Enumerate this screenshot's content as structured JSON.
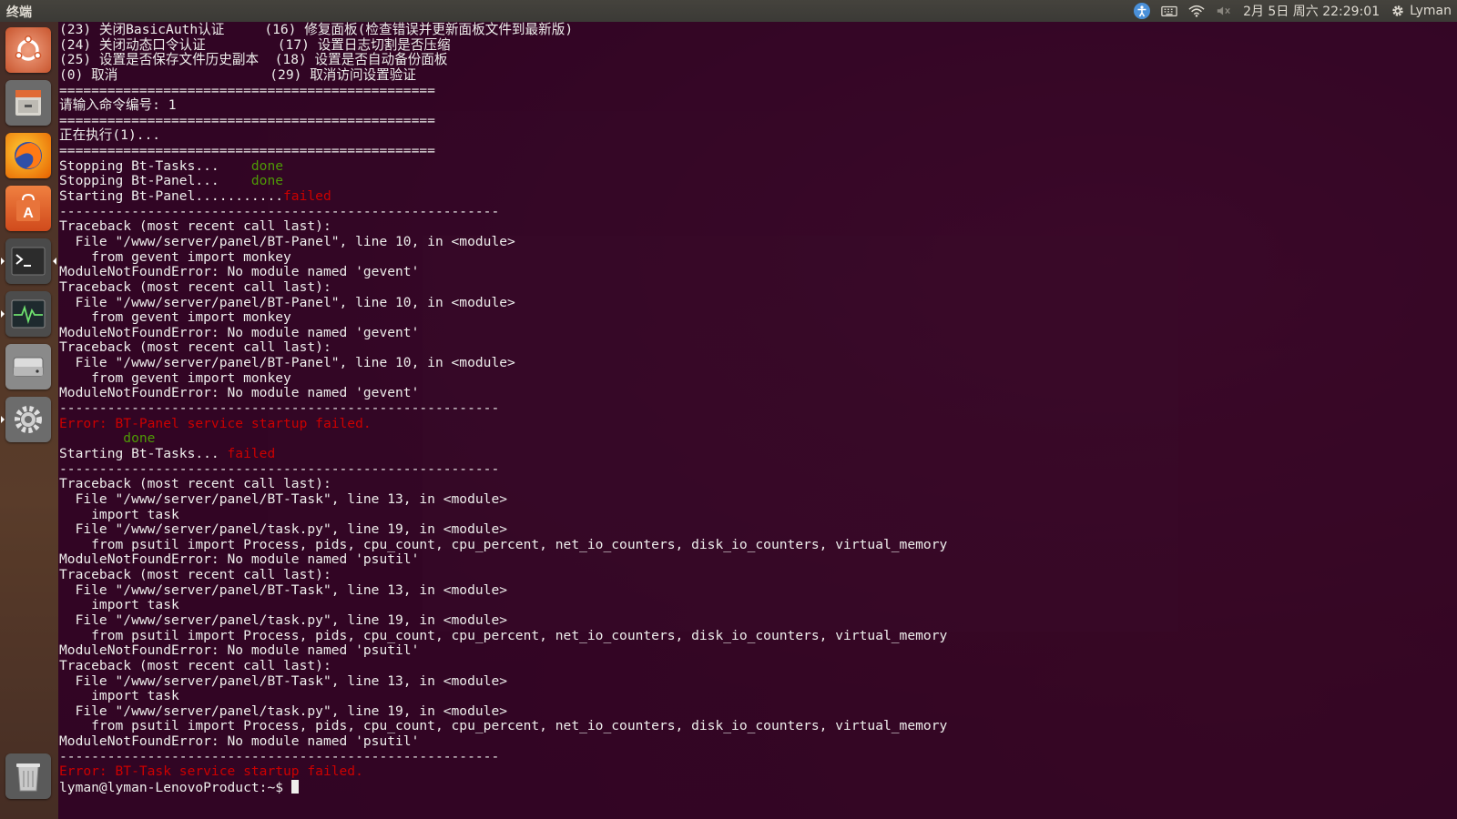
{
  "topbar": {
    "title": "终端",
    "clock": "2月 5日 周六 22:29:01",
    "user": "Lyman",
    "icons": [
      "accessibility-icon",
      "keyboard-icon",
      "wifi-icon",
      "volume-muted-icon",
      "gear-icon"
    ]
  },
  "launcher": {
    "items": [
      {
        "name": "ubuntu-dash",
        "icon": "ubuntu-logo-icon"
      },
      {
        "name": "files",
        "icon": "file-cabinet-icon"
      },
      {
        "name": "firefox",
        "icon": "firefox-icon"
      },
      {
        "name": "software-center",
        "icon": "software-bag-icon"
      },
      {
        "name": "terminal",
        "icon": "terminal-icon"
      },
      {
        "name": "system-monitor",
        "icon": "system-monitor-icon"
      },
      {
        "name": "drive",
        "icon": "drive-icon"
      },
      {
        "name": "system-settings",
        "icon": "settings-gear-icon"
      },
      {
        "name": "trash",
        "icon": "trash-icon"
      }
    ]
  },
  "terminal": {
    "menu": [
      "(23) 关闭BasicAuth认证     (16) 修复面板(检查错误并更新面板文件到最新版)",
      "(24) 关闭动态口令认证         (17) 设置日志切割是否压缩",
      "(25) 设置是否保存文件历史副本  (18) 设置是否自动备份面板",
      "(0) 取消                   (29) 取消访问设置验证"
    ],
    "sep_eq": "===============================================",
    "prompt_cmd": "请输入命令编号: 1",
    "executing": "正在执行(1)...",
    "stop_tasks": "Stopping Bt-Tasks...    ",
    "stop_panel": "Stopping Bt-Panel...    ",
    "start_panel": "Starting Bt-Panel...........",
    "done": "done",
    "failed": "failed",
    "sep_dash": "-------------------------------------------------------",
    "tb_head": "Traceback (most recent call last):",
    "panel_file": "  File \"/www/server/panel/BT-Panel\", line 10, in <module>",
    "panel_import": "    from gevent import monkey",
    "panel_err": "ModuleNotFoundError: No module named 'gevent'",
    "panel_fail": "Error: BT-Panel service startup failed.",
    "indent_done": "        done",
    "start_tasks": "Starting Bt-Tasks... ",
    "task_file": "  File \"/www/server/panel/BT-Task\", line 13, in <module>",
    "task_import": "    import task",
    "taskpy_file": "  File \"/www/server/panel/task.py\", line 19, in <module>",
    "psutil_import": "    from psutil import Process, pids, cpu_count, cpu_percent, net_io_counters, disk_io_counters, virtual_memory",
    "task_err": "ModuleNotFoundError: No module named 'psutil'",
    "task_fail": "Error: BT-Task service startup failed.",
    "prompt": "lyman@lyman-LenovoProduct:~$ "
  }
}
